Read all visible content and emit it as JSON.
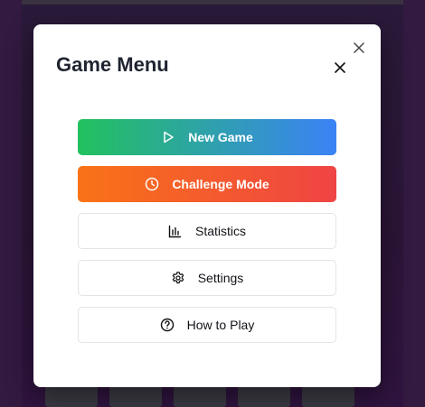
{
  "modal": {
    "title": "Game Menu",
    "close_icon": "close-icon",
    "buttons": [
      {
        "label": "New Game",
        "icon": "play-icon",
        "style": "green-blue-gradient"
      },
      {
        "label": "Challenge Mode",
        "icon": "clock-icon",
        "style": "orange-red-gradient"
      },
      {
        "label": "Statistics",
        "icon": "bar-chart-icon",
        "style": "outline"
      },
      {
        "label": "Settings",
        "icon": "gear-icon",
        "style": "outline"
      },
      {
        "label": "How to Play",
        "icon": "help-circle-icon",
        "style": "outline"
      }
    ]
  },
  "colors": {
    "new_game_gradient": [
      "#22c15e",
      "#3b82f6"
    ],
    "challenge_gradient": [
      "#f97316",
      "#ef4444"
    ],
    "backdrop": "#2a1a3a",
    "title": "#1f2430"
  }
}
